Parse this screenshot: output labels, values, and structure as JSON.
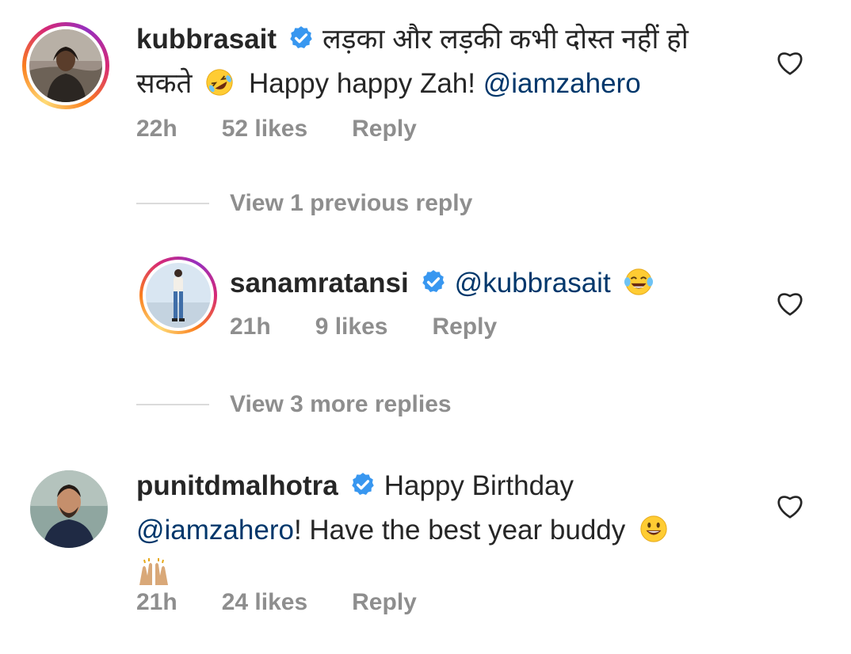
{
  "comments": [
    {
      "username": "kubbrasait",
      "text_line1": "लड़का और लड़की कभी दोस्त नहीं हो",
      "text_line2_prefix": "सकते",
      "text_line2_body": "Happy happy Zah!",
      "mention": "@iamzahero",
      "time": "22h",
      "likes": "52 likes",
      "reply": "Reply",
      "emoji": "rolling-on-floor-laughing-emoji"
    },
    {
      "username": "sanamratansi",
      "mention": "@kubbrasait",
      "time": "21h",
      "likes": "9 likes",
      "reply": "Reply",
      "emoji": "tears-of-joy-emoji"
    },
    {
      "username": "punitdmalhotra",
      "text_line1": "Happy Birthday",
      "mention": "@iamzahero",
      "text_line2_rest": "! Have the best year buddy",
      "time": "21h",
      "likes": "24 likes",
      "reply": "Reply",
      "emoji": "smiley-emoji",
      "emoji2": "raising-hands-emoji"
    }
  ],
  "view_previous": "View 1 previous reply",
  "view_more": "View 3 more replies",
  "colors": {
    "text": "#262626",
    "meta": "#8e8e8e",
    "mention": "#00376b",
    "verified": "#3897f0"
  }
}
